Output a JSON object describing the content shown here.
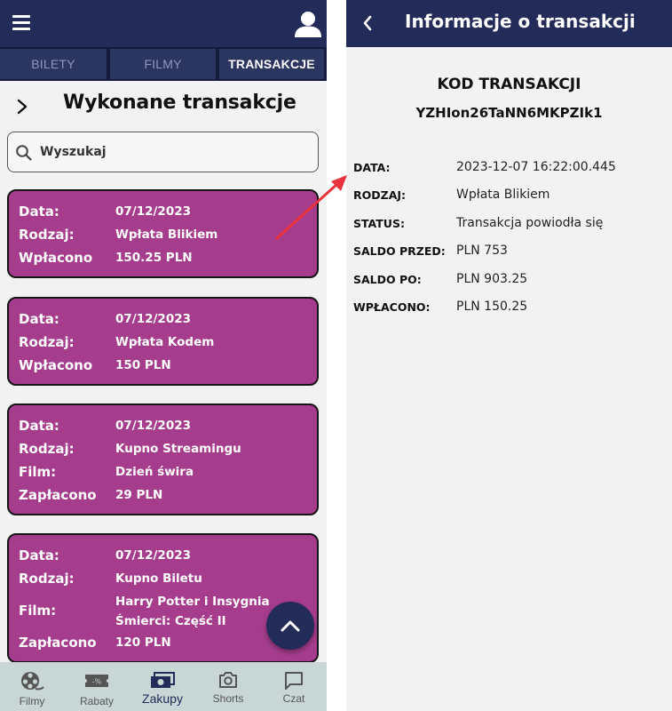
{
  "left_screen": {
    "tabs": [
      {
        "label": "BILETY",
        "active": false
      },
      {
        "label": "FILMY",
        "active": false
      },
      {
        "label": "TRANSAKCJE",
        "active": true
      }
    ],
    "page_title": "Wykonane transakcje",
    "search": {
      "placeholder": "Wyszukaj"
    },
    "cards": [
      {
        "rows": [
          {
            "field": "Data:",
            "value": "07/12/2023"
          },
          {
            "field": "Rodzaj:",
            "value": "Wpłata Blikiem"
          },
          {
            "field": "Wpłacono",
            "value": "150.25 PLN"
          }
        ]
      },
      {
        "rows": [
          {
            "field": "Data:",
            "value": "07/12/2023"
          },
          {
            "field": "Rodzaj:",
            "value": "Wpłata Kodem"
          },
          {
            "field": "Wpłacono",
            "value": "150 PLN"
          }
        ]
      },
      {
        "rows": [
          {
            "field": "Data:",
            "value": "07/12/2023"
          },
          {
            "field": "Rodzaj:",
            "value": "Kupno Streamingu"
          },
          {
            "field": "Film:",
            "value": "Dzień świra"
          },
          {
            "field": "Zapłacono",
            "value": "29 PLN"
          }
        ]
      },
      {
        "rows": [
          {
            "field": "Data:",
            "value": "07/12/2023"
          },
          {
            "field": "Rodzaj:",
            "value": "Kupno Biletu"
          },
          {
            "field": "Film:",
            "value_line1": "Harry Potter i Insygnia",
            "value_line2": "Śmierci: Część II"
          },
          {
            "field": "Zapłacono",
            "value": "120 PLN"
          }
        ]
      }
    ],
    "bottom_nav": [
      {
        "label": "Filmy",
        "icon": "film-reel-icon",
        "active": false
      },
      {
        "label": "Rabaty",
        "icon": "discount-ticket-icon",
        "active": false
      },
      {
        "label": "Zakupy",
        "icon": "money-icon",
        "active": true
      },
      {
        "label": "Shorts",
        "icon": "camera-icon",
        "active": false
      },
      {
        "label": "Czat",
        "icon": "chat-icon",
        "active": false
      }
    ],
    "icons": {
      "menu": "menu-icon",
      "profile": "profile-icon",
      "scroll_top": "chevron-up-icon"
    }
  },
  "right_screen": {
    "title": "Informacje o transakcji",
    "code_label": "KOD TRANSAKCJI",
    "code_value": "YZHIon26TaNN6MKPZIk1",
    "details": [
      {
        "label": "DATA:",
        "value": "2023-12-07 16:22:00.445"
      },
      {
        "label": "RODZAJ:",
        "value": "Wpłata Blikiem"
      },
      {
        "label": "STATUS:",
        "value": "Transakcja powiodła się"
      },
      {
        "label": "SALDO PRZED:",
        "value": "PLN 753"
      },
      {
        "label": "SALDO PO:",
        "value": "PLN 903.25"
      },
      {
        "label": "WPŁACONO:",
        "value": "PLN 150.25"
      }
    ]
  },
  "colors": {
    "header_navy": "#232b58",
    "card_magenta": "#a63d8c",
    "bottom_nav_bg": "#c9d6d6",
    "annotation_arrow": "#e8323c"
  }
}
